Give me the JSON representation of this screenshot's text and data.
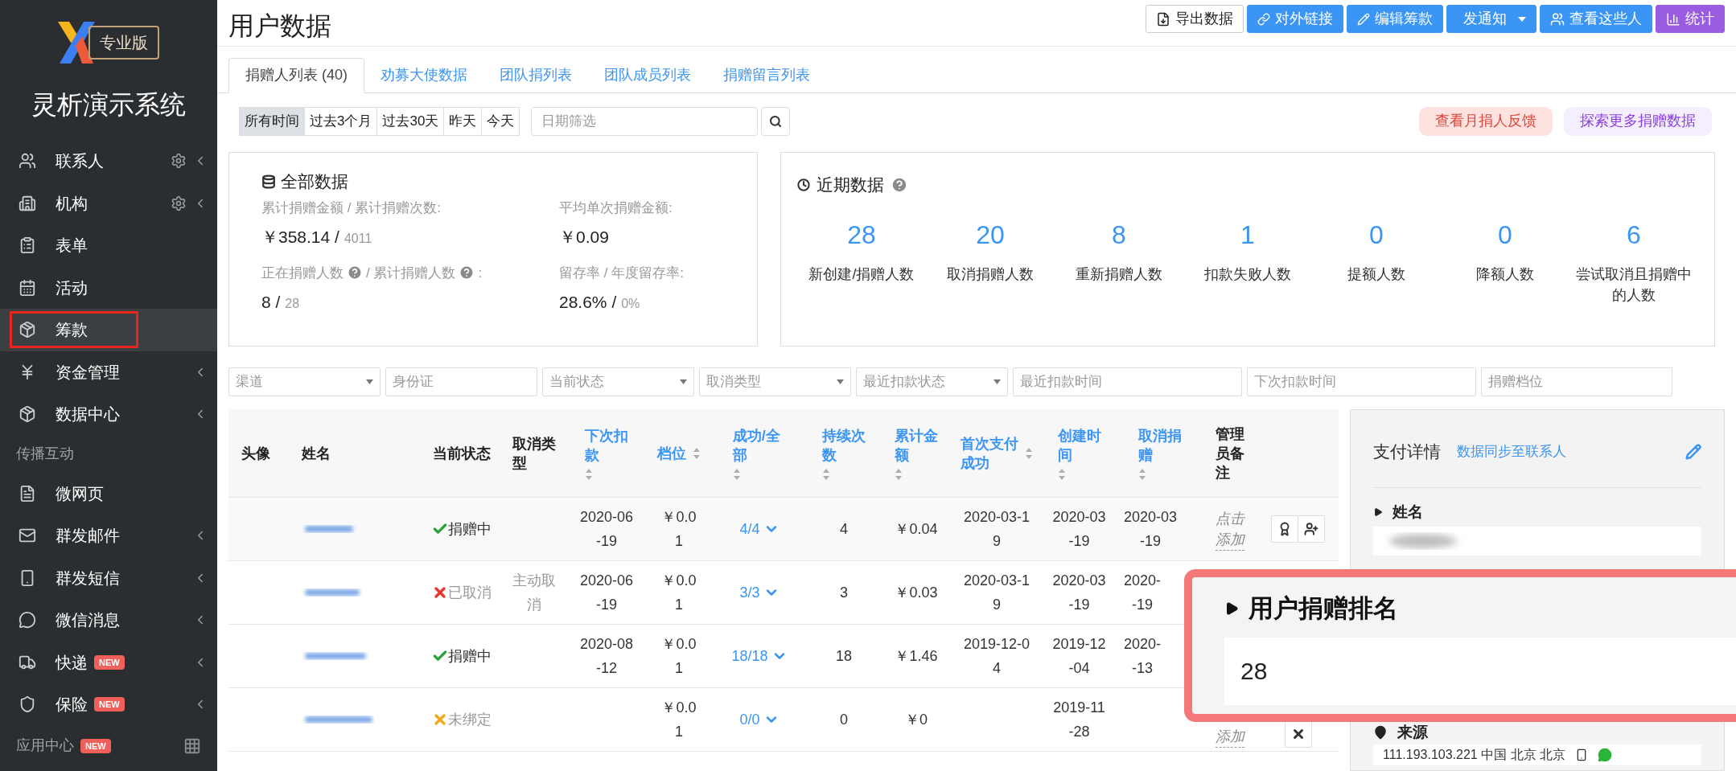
{
  "sidebar": {
    "badge": "专业版",
    "title": "灵析演示系统",
    "items": [
      {
        "kind": "item",
        "label": "联系人",
        "gear": true,
        "caret": true,
        "selected": false
      },
      {
        "kind": "item",
        "label": "机构",
        "gear": true,
        "caret": true,
        "selected": false
      },
      {
        "kind": "item",
        "label": "表单",
        "gear": false,
        "caret": false,
        "selected": false
      },
      {
        "kind": "item",
        "label": "活动",
        "gear": false,
        "caret": false,
        "selected": false
      },
      {
        "kind": "item",
        "label": "筹款",
        "gear": false,
        "caret": false,
        "selected": true
      },
      {
        "kind": "item",
        "label": "资金管理",
        "gear": false,
        "caret": true,
        "selected": false
      },
      {
        "kind": "item",
        "label": "数据中心",
        "gear": false,
        "caret": true,
        "selected": false
      },
      {
        "kind": "section",
        "label": "传播互动"
      },
      {
        "kind": "item",
        "label": "微网页",
        "gear": false,
        "caret": false,
        "selected": false
      },
      {
        "kind": "item",
        "label": "群发邮件",
        "gear": false,
        "caret": true,
        "selected": false
      },
      {
        "kind": "item",
        "label": "群发短信",
        "gear": false,
        "caret": true,
        "selected": false
      },
      {
        "kind": "item",
        "label": "微信消息",
        "gear": false,
        "caret": true,
        "selected": false
      },
      {
        "kind": "item",
        "label": "快递",
        "tag": "NEW",
        "gear": false,
        "caret": true,
        "selected": false
      },
      {
        "kind": "item",
        "label": "保险",
        "tag": "NEW",
        "gear": false,
        "caret": true,
        "selected": false
      }
    ],
    "footer": {
      "label": "应用中心",
      "tag": "NEW"
    }
  },
  "header": {
    "title": "用户数据",
    "buttons": [
      {
        "label": "导出数据",
        "kind": "outline"
      },
      {
        "label": "对外链接",
        "kind": "primary"
      },
      {
        "label": "编辑筹款",
        "kind": "primary"
      },
      {
        "label": "发通知",
        "kind": "dropdown"
      },
      {
        "label": "查看这些人",
        "kind": "primary"
      },
      {
        "label": "统计",
        "kind": "accent"
      }
    ]
  },
  "tabs": [
    {
      "label": "捐赠人列表 (40)",
      "selected": true
    },
    {
      "label": "劝募大使数据",
      "selected": false
    },
    {
      "label": "团队捐列表",
      "selected": false
    },
    {
      "label": "团队成员列表",
      "selected": false
    },
    {
      "label": "捐赠留言列表",
      "selected": false
    }
  ],
  "time_filters": [
    {
      "label": "所有时间",
      "selected": true
    },
    {
      "label": "过去3个月",
      "selected": false
    },
    {
      "label": "过去30天",
      "selected": false
    },
    {
      "label": "昨天",
      "selected": false
    },
    {
      "label": "今天",
      "selected": false
    }
  ],
  "date_filter": {
    "placeholder": "日期筛选"
  },
  "pill_links": [
    "查看月捐人反馈",
    "探索更多捐赠数据"
  ],
  "overall": {
    "title": "全部数据",
    "stats": [
      {
        "label_parts": [
          "累计捐赠金额 / 累计捐赠次数:"
        ],
        "value": "￥358.14 /",
        "sub": "4011"
      },
      {
        "label_parts": [
          "平均单次捐赠金额:"
        ],
        "value": "￥0.09"
      },
      {
        "label_parts": [
          "正在捐赠人数",
          "/ 累计捐赠人数",
          ":"
        ],
        "value": "8 /",
        "sub": "28"
      },
      {
        "label_parts": [
          "留存率 / 年度留存率:"
        ],
        "value": "28.6% /",
        "sub": "0%"
      }
    ]
  },
  "recent": {
    "title": "近期数据",
    "metrics": [
      {
        "value": "28",
        "label": "新创建/捐赠人数"
      },
      {
        "value": "20",
        "label": "取消捐赠人数"
      },
      {
        "value": "8",
        "label": "重新捐赠人数"
      },
      {
        "value": "1",
        "label": "扣款失败人数"
      },
      {
        "value": "0",
        "label": "提额人数"
      },
      {
        "value": "0",
        "label": "降额人数"
      },
      {
        "value": "6",
        "label": "尝试取消且捐赠中的人数"
      }
    ]
  },
  "filters": [
    {
      "placeholder": "渠道",
      "kind": "select"
    },
    {
      "placeholder": "身份证",
      "kind": "input"
    },
    {
      "placeholder": "当前状态",
      "kind": "select"
    },
    {
      "placeholder": "取消类型",
      "kind": "select"
    },
    {
      "placeholder": "最近扣款状态",
      "kind": "select"
    },
    {
      "placeholder": "最近扣款时间",
      "kind": "input"
    },
    {
      "placeholder": "下次扣款时间",
      "kind": "input"
    },
    {
      "placeholder": "捐赠档位",
      "kind": "input"
    }
  ],
  "table": {
    "columns": [
      {
        "label": "头像",
        "sortable": false
      },
      {
        "label": "姓名",
        "sortable": false
      },
      {
        "label": "当前状态",
        "sortable": false
      },
      {
        "label": "取消类型",
        "sortable": false
      },
      {
        "label": "下次扣款",
        "sortable": true
      },
      {
        "label": "档位",
        "sortable": true
      },
      {
        "label": "成功/全部",
        "sortable": true
      },
      {
        "label": "持续次数",
        "sortable": true
      },
      {
        "label": "累计金额",
        "sortable": true
      },
      {
        "label": "首次支付成功",
        "sortable": true
      },
      {
        "label": "创建时间",
        "sortable": true
      },
      {
        "label": "取消捐赠",
        "sortable": true
      },
      {
        "label": "管理员备注",
        "sortable": false
      }
    ],
    "rows": [
      {
        "kind": "active",
        "status": "捐赠中",
        "next": "2020-06\n-19",
        "tier": "￥0.0\n1",
        "ratio": "4/4",
        "streak": "4",
        "total": "￥0.04",
        "first": "2020-03-1\n9",
        "created": "2020-03\n-19",
        "cancelled": "2020-03\n-19",
        "note": "点击添加"
      },
      {
        "kind": "cancelled",
        "status": "已取消",
        "cancel_type": "主动取消",
        "next": "2020-06\n-19",
        "tier": "￥0.0\n1",
        "ratio": "3/3",
        "streak": "3",
        "total": "￥0.03",
        "first": "2020-03-1\n9",
        "created": "2020-03\n-19",
        "cancelled": "2020-\n-19"
      },
      {
        "kind": "active",
        "status": "捐赠中",
        "next": "2020-08\n-12",
        "tier": "￥0.0\n1",
        "ratio": "18/18",
        "streak": "18",
        "total": "￥1.46",
        "first": "2019-12-0\n4",
        "created": "2019-12\n-04",
        "cancelled": "2020-\n-13"
      },
      {
        "kind": "unbound",
        "status": "未绑定",
        "tier": "￥0.0\n1",
        "ratio": "0/0",
        "streak": "0",
        "total": "￥0",
        "created": "2019-11\n-28",
        "note": "添加"
      }
    ]
  },
  "detail": {
    "title": "支付详情",
    "link": "数据同步至联系人",
    "sections": [
      {
        "label": "姓名"
      },
      {
        "label": "来源",
        "value": "111.193.103.221 中国 北京 北京"
      }
    ]
  },
  "callout": {
    "title": "用户捐赠排名",
    "value": "28"
  }
}
